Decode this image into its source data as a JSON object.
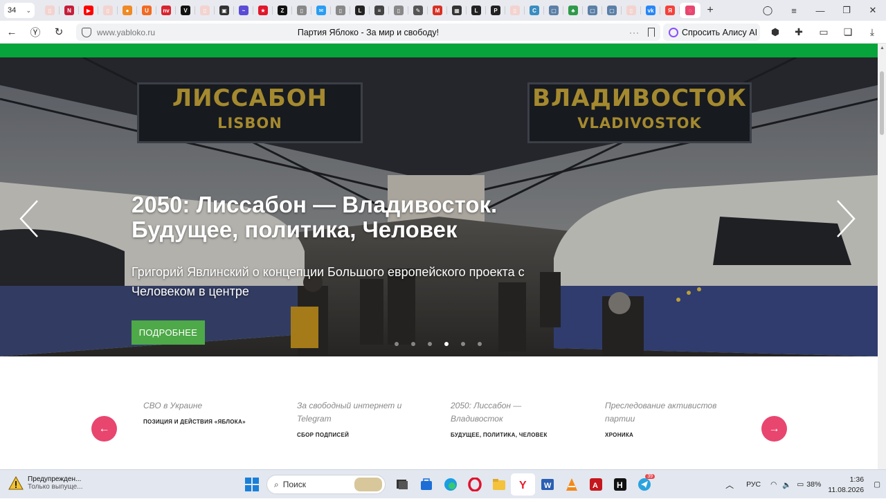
{
  "browser": {
    "tab_count": "34",
    "tabs": [
      {
        "icon": "pdf-icon",
        "color": "#f3d3cf",
        "glyph": "▯"
      },
      {
        "icon": "red-n-icon",
        "color": "#c51e3a",
        "glyph": "N"
      },
      {
        "icon": "youtube-icon",
        "color": "#ff0000",
        "glyph": "▶"
      },
      {
        "icon": "pdf-icon",
        "color": "#f3d3cf",
        "glyph": "▯"
      },
      {
        "icon": "orange-circle-icon",
        "color": "#f08a24",
        "glyph": "●"
      },
      {
        "icon": "u-icon",
        "color": "#f26b21",
        "glyph": "U"
      },
      {
        "icon": "nv-icon",
        "color": "#d9232e",
        "glyph": "nv"
      },
      {
        "icon": "vt-icon",
        "color": "#111111",
        "glyph": "V"
      },
      {
        "icon": "pdf-icon",
        "color": "#f3d3cf",
        "glyph": "▯"
      },
      {
        "icon": "gear-box-icon",
        "color": "#333333",
        "glyph": "▣"
      },
      {
        "icon": "swirl-icon",
        "color": "#5a4cd6",
        "glyph": "~"
      },
      {
        "icon": "star-icon",
        "color": "#e0182a",
        "glyph": "★"
      },
      {
        "icon": "z-icon",
        "color": "#111111",
        "glyph": "Z"
      },
      {
        "icon": "doc-icon",
        "color": "#888888",
        "glyph": "▯"
      },
      {
        "icon": "chat-icon",
        "color": "#2a9df4",
        "glyph": "✉"
      },
      {
        "icon": "doc-icon",
        "color": "#888888",
        "glyph": "▯"
      },
      {
        "icon": "l-icon",
        "color": "#222222",
        "glyph": "L"
      },
      {
        "icon": "news-icon",
        "color": "#444444",
        "glyph": "≡"
      },
      {
        "icon": "doc-icon",
        "color": "#888888",
        "glyph": "▯"
      },
      {
        "icon": "pen-icon",
        "color": "#555555",
        "glyph": "✎"
      },
      {
        "icon": "gmail-icon",
        "color": "#d93025",
        "glyph": "M"
      },
      {
        "icon": "grid-icon",
        "color": "#333333",
        "glyph": "▦"
      },
      {
        "icon": "l-icon",
        "color": "#222222",
        "glyph": "L"
      },
      {
        "icon": "rkg-icon",
        "color": "#222222",
        "glyph": "Р"
      },
      {
        "icon": "pdf-icon",
        "color": "#f3d3cf",
        "glyph": "▯"
      },
      {
        "icon": "c-icon",
        "color": "#3a8dc0",
        "glyph": "C"
      },
      {
        "icon": "puzzle-icon",
        "color": "#5b7fa6",
        "glyph": "▢"
      },
      {
        "icon": "leaf-icon",
        "color": "#2e9a4a",
        "glyph": "♣"
      },
      {
        "icon": "puzzle-icon",
        "color": "#5b7fa6",
        "glyph": "▢"
      },
      {
        "icon": "puzzle-icon",
        "color": "#5b7fa6",
        "glyph": "▢"
      },
      {
        "icon": "pdf-icon",
        "color": "#f3d3cf",
        "glyph": "▯"
      },
      {
        "icon": "vk-icon",
        "color": "#2787f5",
        "glyph": "vk"
      },
      {
        "icon": "yandex-icon",
        "color": "#f5413b",
        "glyph": "Я"
      },
      {
        "icon": "yabloko-icon",
        "color": "#e8466f",
        "glyph": "◌",
        "active": true
      }
    ],
    "address": "www.yabloko.ru",
    "page_title": "Партия Яблоко - За мир и свободу!",
    "alice_label": "Спросить Алису AI",
    "dots": "···"
  },
  "hero": {
    "sign_left_ru": "ЛИССАБОН",
    "sign_left_en": "LISBON",
    "sign_right_ru": "ВЛАДИВОСТОК",
    "sign_right_en": "VLADIVOSTOK",
    "title": "2050: Лиссабон — Владивосток. Будущее, политика, Человек",
    "subtitle": "Григорий Явлинский о концепции Большого европейского проекта с Человеком в центре",
    "button": "ПОДРОБНЕЕ",
    "slide_count": 6,
    "active_slide": 4,
    "accent_green": "#07a33b",
    "button_green": "#4ea948"
  },
  "cards": [
    {
      "title": "СВО в Украине",
      "sub": "ПОЗИЦИЯ И ДЕЙСТВИЯ «ЯБЛОКА»"
    },
    {
      "title": "За свободный интернет и Telegram",
      "sub": "СБОР ПОДПИСЕЙ"
    },
    {
      "title": "2050: Лиссабон — Владивосток",
      "sub": "БУДУЩЕЕ, ПОЛИТИКА, ЧЕЛОВЕК"
    },
    {
      "title": "Преследование активистов партии",
      "sub": "ХРОНИКА"
    }
  ],
  "carousel_accent": "#e8466f",
  "taskbar": {
    "notice_title": "Предупрежден...",
    "notice_sub": "Только выпуще...",
    "search_placeholder": "Поиск",
    "lang": "РУС",
    "battery": "38%",
    "time": "1:36",
    "date": "11.08.2026",
    "telegram_badge": "39"
  }
}
